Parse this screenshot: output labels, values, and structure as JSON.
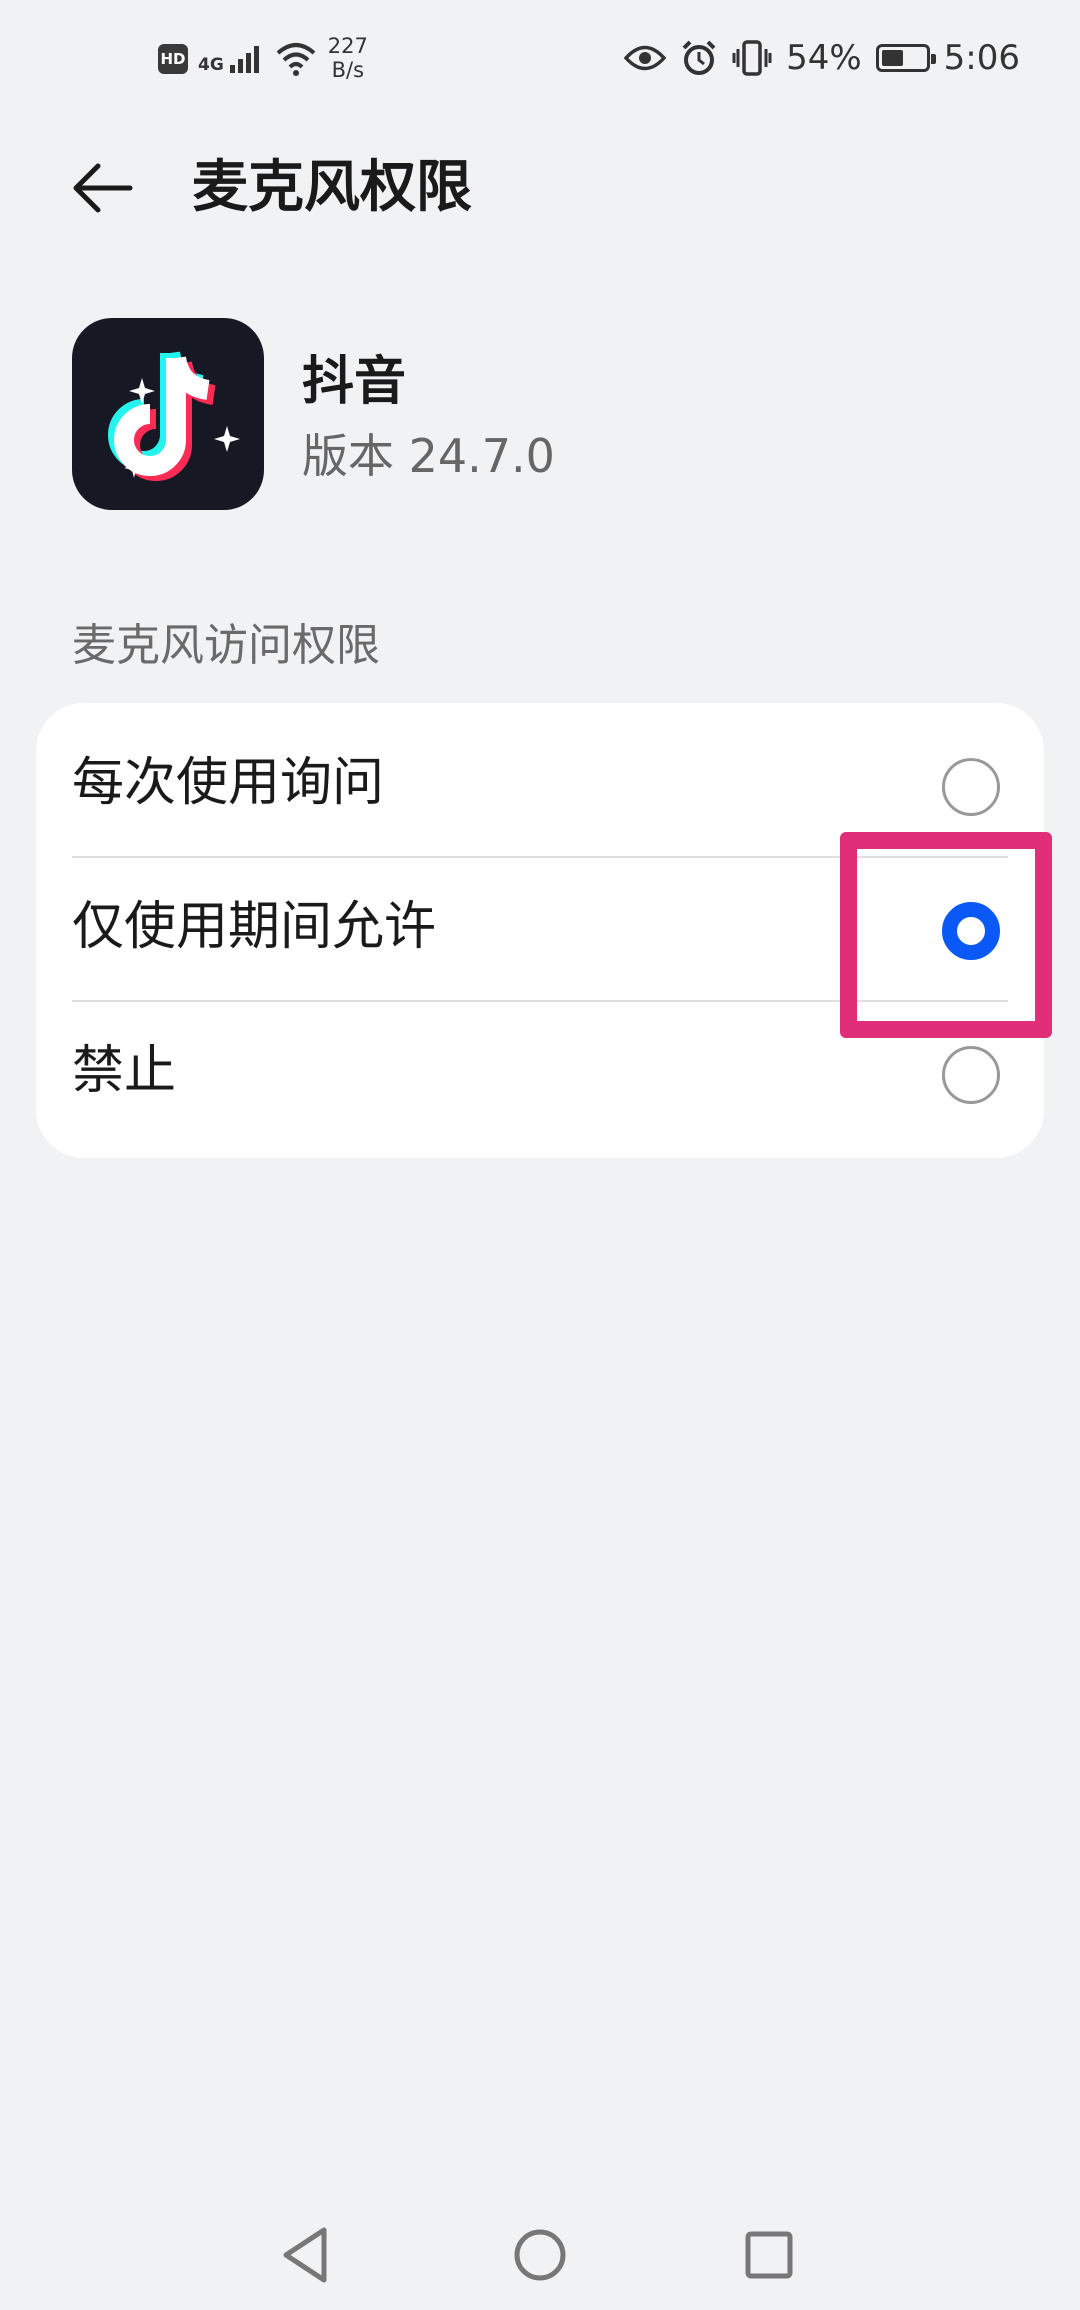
{
  "status_bar": {
    "hd": "HD",
    "network": "4G",
    "speed_value": "227",
    "speed_unit": "B/s",
    "battery_percent": "54%",
    "battery_level": 0.54,
    "time": "5:06"
  },
  "header": {
    "title": "麦克风权限"
  },
  "app": {
    "name": "抖音",
    "version": "版本 24.7.0"
  },
  "section": {
    "label": "麦克风访问权限"
  },
  "options": [
    {
      "label": "每次使用询问",
      "checked": false
    },
    {
      "label": "仅使用期间允许",
      "checked": true
    },
    {
      "label": "禁止",
      "checked": false
    }
  ],
  "colors": {
    "accent": "#0a59f7",
    "highlight": "#e02f78",
    "background": "#f1f2f4"
  }
}
